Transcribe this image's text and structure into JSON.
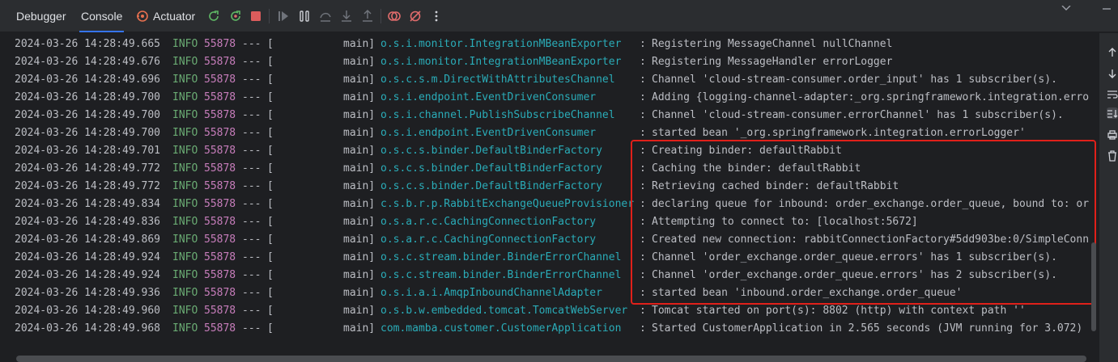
{
  "tabs": [
    {
      "label": "Debugger"
    },
    {
      "label": "Console"
    },
    {
      "label": "Actuator"
    }
  ],
  "toolbar": {
    "icons": [
      "rerun-icon",
      "rerun-failed-icon",
      "stop-icon",
      "resume-icon",
      "pause-icon",
      "step-over-icon",
      "step-into-icon",
      "step-out-icon",
      "view-breakpoints-icon",
      "mute-breakpoints-icon",
      "more-options-icon"
    ]
  },
  "colors": {
    "background": "#1e1f22",
    "toolbar": "#2b2d30",
    "info": "#6aab73",
    "pid": "#c77dbb",
    "logger": "#2aacb8",
    "text": "#bcbec4",
    "highlight": "#e0201a",
    "active_tab_underline": "#3574f0"
  },
  "log_lines": [
    {
      "ts": "2024-03-26 14:28:49.665",
      "level": "INFO",
      "pid": "55878",
      "sep": "---",
      "lbracket": "[",
      "thread": "main]",
      "logger": "o.s.i.monitor.IntegrationMBeanExporter",
      "colon": ":",
      "message": "Registering MessageChannel nullChannel"
    },
    {
      "ts": "2024-03-26 14:28:49.676",
      "level": "INFO",
      "pid": "55878",
      "sep": "---",
      "lbracket": "[",
      "thread": "main]",
      "logger": "o.s.i.monitor.IntegrationMBeanExporter",
      "colon": ":",
      "message": "Registering MessageHandler errorLogger"
    },
    {
      "ts": "2024-03-26 14:28:49.696",
      "level": "INFO",
      "pid": "55878",
      "sep": "---",
      "lbracket": "[",
      "thread": "main]",
      "logger": "o.s.c.s.m.DirectWithAttributesChannel",
      "colon": ":",
      "message": "Channel 'cloud-stream-consumer.order_input' has 1 subscriber(s)."
    },
    {
      "ts": "2024-03-26 14:28:49.700",
      "level": "INFO",
      "pid": "55878",
      "sep": "---",
      "lbracket": "[",
      "thread": "main]",
      "logger": "o.s.i.endpoint.EventDrivenConsumer",
      "colon": ":",
      "message": "Adding {logging-channel-adapter:_org.springframework.integration.erro"
    },
    {
      "ts": "2024-03-26 14:28:49.700",
      "level": "INFO",
      "pid": "55878",
      "sep": "---",
      "lbracket": "[",
      "thread": "main]",
      "logger": "o.s.i.channel.PublishSubscribeChannel",
      "colon": ":",
      "message": "Channel 'cloud-stream-consumer.errorChannel' has 1 subscriber(s)."
    },
    {
      "ts": "2024-03-26 14:28:49.700",
      "level": "INFO",
      "pid": "55878",
      "sep": "---",
      "lbracket": "[",
      "thread": "main]",
      "logger": "o.s.i.endpoint.EventDrivenConsumer",
      "colon": ":",
      "message": "started bean '_org.springframework.integration.errorLogger'"
    },
    {
      "ts": "2024-03-26 14:28:49.701",
      "level": "INFO",
      "pid": "55878",
      "sep": "---",
      "lbracket": "[",
      "thread": "main]",
      "logger": "o.s.c.s.binder.DefaultBinderFactory",
      "colon": ":",
      "message": "Creating binder: defaultRabbit"
    },
    {
      "ts": "2024-03-26 14:28:49.772",
      "level": "INFO",
      "pid": "55878",
      "sep": "---",
      "lbracket": "[",
      "thread": "main]",
      "logger": "o.s.c.s.binder.DefaultBinderFactory",
      "colon": ":",
      "message": "Caching the binder: defaultRabbit"
    },
    {
      "ts": "2024-03-26 14:28:49.772",
      "level": "INFO",
      "pid": "55878",
      "sep": "---",
      "lbracket": "[",
      "thread": "main]",
      "logger": "o.s.c.s.binder.DefaultBinderFactory",
      "colon": ":",
      "message": "Retrieving cached binder: defaultRabbit"
    },
    {
      "ts": "2024-03-26 14:28:49.834",
      "level": "INFO",
      "pid": "55878",
      "sep": "---",
      "lbracket": "[",
      "thread": "main]",
      "logger": "c.s.b.r.p.RabbitExchangeQueueProvisioner",
      "colon": ":",
      "message": "declaring queue for inbound: order_exchange.order_queue, bound to: or"
    },
    {
      "ts": "2024-03-26 14:28:49.836",
      "level": "INFO",
      "pid": "55878",
      "sep": "---",
      "lbracket": "[",
      "thread": "main]",
      "logger": "o.s.a.r.c.CachingConnectionFactory",
      "colon": ":",
      "message": "Attempting to connect to: [localhost:5672]"
    },
    {
      "ts": "2024-03-26 14:28:49.869",
      "level": "INFO",
      "pid": "55878",
      "sep": "---",
      "lbracket": "[",
      "thread": "main]",
      "logger": "o.s.a.r.c.CachingConnectionFactory",
      "colon": ":",
      "message": "Created new connection: rabbitConnectionFactory#5dd903be:0/SimpleConn"
    },
    {
      "ts": "2024-03-26 14:28:49.924",
      "level": "INFO",
      "pid": "55878",
      "sep": "---",
      "lbracket": "[",
      "thread": "main]",
      "logger": "o.s.c.stream.binder.BinderErrorChannel",
      "colon": ":",
      "message": "Channel 'order_exchange.order_queue.errors' has 1 subscriber(s)."
    },
    {
      "ts": "2024-03-26 14:28:49.924",
      "level": "INFO",
      "pid": "55878",
      "sep": "---",
      "lbracket": "[",
      "thread": "main]",
      "logger": "o.s.c.stream.binder.BinderErrorChannel",
      "colon": ":",
      "message": "Channel 'order_exchange.order_queue.errors' has 2 subscriber(s)."
    },
    {
      "ts": "2024-03-26 14:28:49.936",
      "level": "INFO",
      "pid": "55878",
      "sep": "---",
      "lbracket": "[",
      "thread": "main]",
      "logger": "o.s.i.a.i.AmqpInboundChannelAdapter",
      "colon": ":",
      "message": "started bean 'inbound.order_exchange.order_queue'"
    },
    {
      "ts": "2024-03-26 14:28:49.960",
      "level": "INFO",
      "pid": "55878",
      "sep": "---",
      "lbracket": "[",
      "thread": "main]",
      "logger": "o.s.b.w.embedded.tomcat.TomcatWebServer",
      "colon": ":",
      "message": "Tomcat started on port(s): 8802 (http) with context path ''"
    },
    {
      "ts": "2024-03-26 14:28:49.968",
      "level": "INFO",
      "pid": "55878",
      "sep": "---",
      "lbracket": "[",
      "thread": "main]",
      "logger": "com.mamba.customer.CustomerApplication",
      "colon": ":",
      "message": "Started CustomerApplication in 2.565 seconds (JVM running for 3.072)"
    }
  ],
  "sidebar": {
    "icons": [
      "scroll-up-icon",
      "scroll-down-icon",
      "soft-wrap-icon",
      "scroll-to-end-icon",
      "print-icon",
      "clear-all-icon"
    ]
  }
}
